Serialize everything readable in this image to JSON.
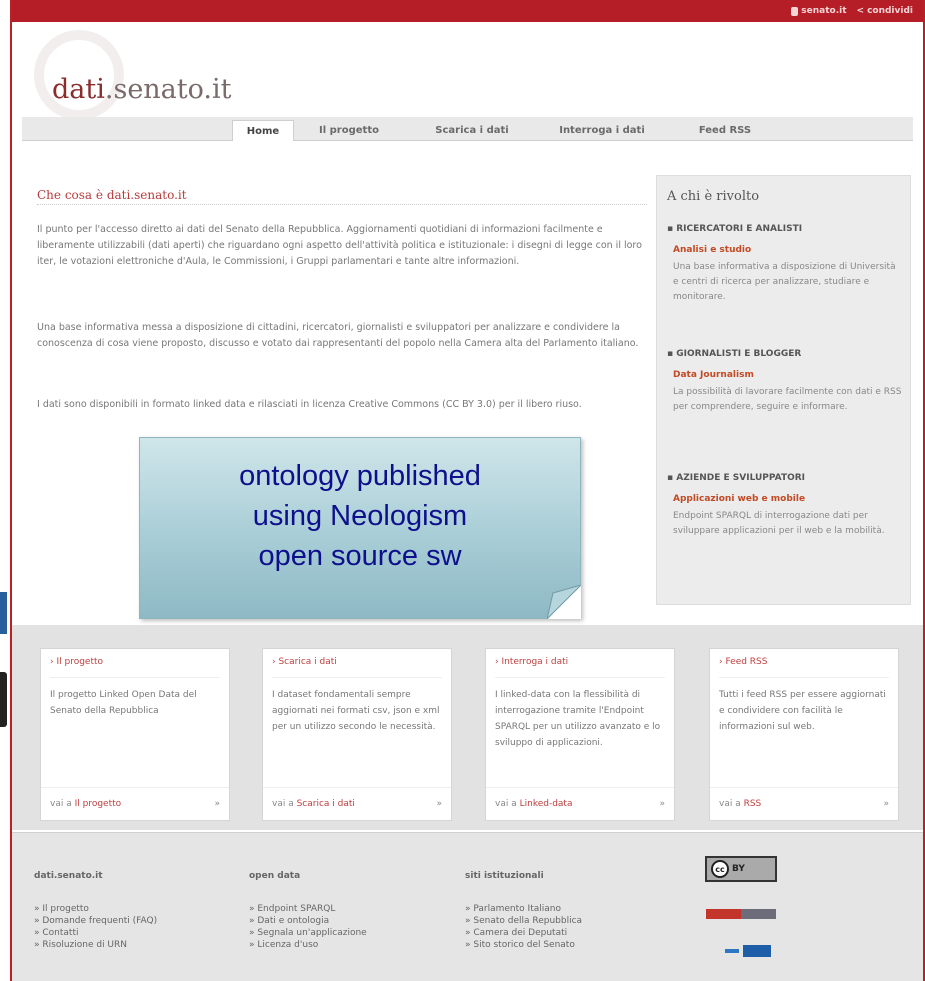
{
  "topbar": {
    "site_link": "senato.it",
    "share": "condividi"
  },
  "brand": {
    "logo_main": "dati",
    "logo_rest": ".senato.it"
  },
  "nav": {
    "tabs": [
      "Home",
      "Il progetto",
      "Scarica i dati",
      "Interroga i dati",
      "Feed RSS"
    ],
    "active": "Home"
  },
  "main": {
    "title": "Che cosa è dati.senato.it",
    "paragraphs": [
      "Il punto per l'accesso diretto ai dati del Senato della Repubblica. Aggiornamenti quotidiani di informazioni facilmente e liberamente utilizzabili (dati aperti) che riguardano ogni aspetto dell'attività politica e istituzionale: i disegni di legge con il loro iter, le votazioni elettroniche d'Aula, le Commissioni, i Gruppi parlamentari e tante altre informazioni.",
      "Una base informativa messa a disposizione di cittadini, ricercatori, giornalisti e sviluppatori per analizzare e condividere la conoscenza di cosa viene proposto, discusso e votato dai rappresentanti del popolo nella Camera alta del Parlamento italiano.",
      "I dati sono disponibili in formato linked data e rilasciati in licenza Creative Commons (CC BY 3.0) per il libero riuso."
    ]
  },
  "sidebar": {
    "title": "A chi è rivolto",
    "groups": [
      {
        "category": "RICERCATORI E ANALISTI",
        "subtitle": "Analisi e studio",
        "text": "Una base informativa a disposizione di Università e centri di ricerca per analizzare, studiare e monitorare."
      },
      {
        "category": "GIORNALISTI E BLOGGER",
        "subtitle": "Data Journalism",
        "text": "La possibilità di lavorare facilmente con dati e RSS per comprendere, seguire e informare."
      },
      {
        "category": "AZIENDE E SVILUPPATORI",
        "subtitle": "Applicazioni web e mobile",
        "text": "Endpoint SPARQL di interrogazione dati per sviluppare applicazioni per il web e la mobilità."
      }
    ]
  },
  "callout": {
    "lines": [
      "ontology published",
      "using Neologism",
      "open source sw"
    ]
  },
  "cards": [
    {
      "head": "Il progetto",
      "body": "Il progetto Linked Open Data del Senato della Repubblica",
      "foot_prefix": "vai a",
      "foot_link": "Il progetto"
    },
    {
      "head": "Scarica i dati",
      "body": "I dataset fondamentali sempre aggiornati nei formati csv, json e xml per un utilizzo secondo le necessità.",
      "foot_prefix": "vai a",
      "foot_link": "Scarica i dati"
    },
    {
      "head": "Interroga i dati",
      "body": "I linked-data con la flessibilità di interrogazione tramite l'Endpoint SPARQL per un utilizzo avanzato e lo sviluppo di applicazioni.",
      "foot_prefix": "vai a",
      "foot_link": "Linked-data"
    },
    {
      "head": "Feed RSS",
      "body": "Tutti i feed RSS per essere aggiornati e condividere con facilità le informazioni sul web.",
      "foot_prefix": "vai a",
      "foot_link": "RSS"
    }
  ],
  "footer": {
    "columns": [
      {
        "heading": "dati.senato.it",
        "links": [
          "Il progetto",
          "Domande frequenti (FAQ)",
          "Contatti",
          "Risoluzione di URN"
        ]
      },
      {
        "heading": "open data",
        "links": [
          "Endpoint SPARQL",
          "Dati e ontologia",
          "Segnala un'applicazione",
          "Licenza d'uso"
        ]
      },
      {
        "heading": "siti istituzionali",
        "links": [
          "Parlamento Italiano",
          "Senato della Repubblica",
          "Camera dei Deputati",
          "Sito storico del Senato"
        ]
      }
    ],
    "badge_cc": "BY"
  }
}
